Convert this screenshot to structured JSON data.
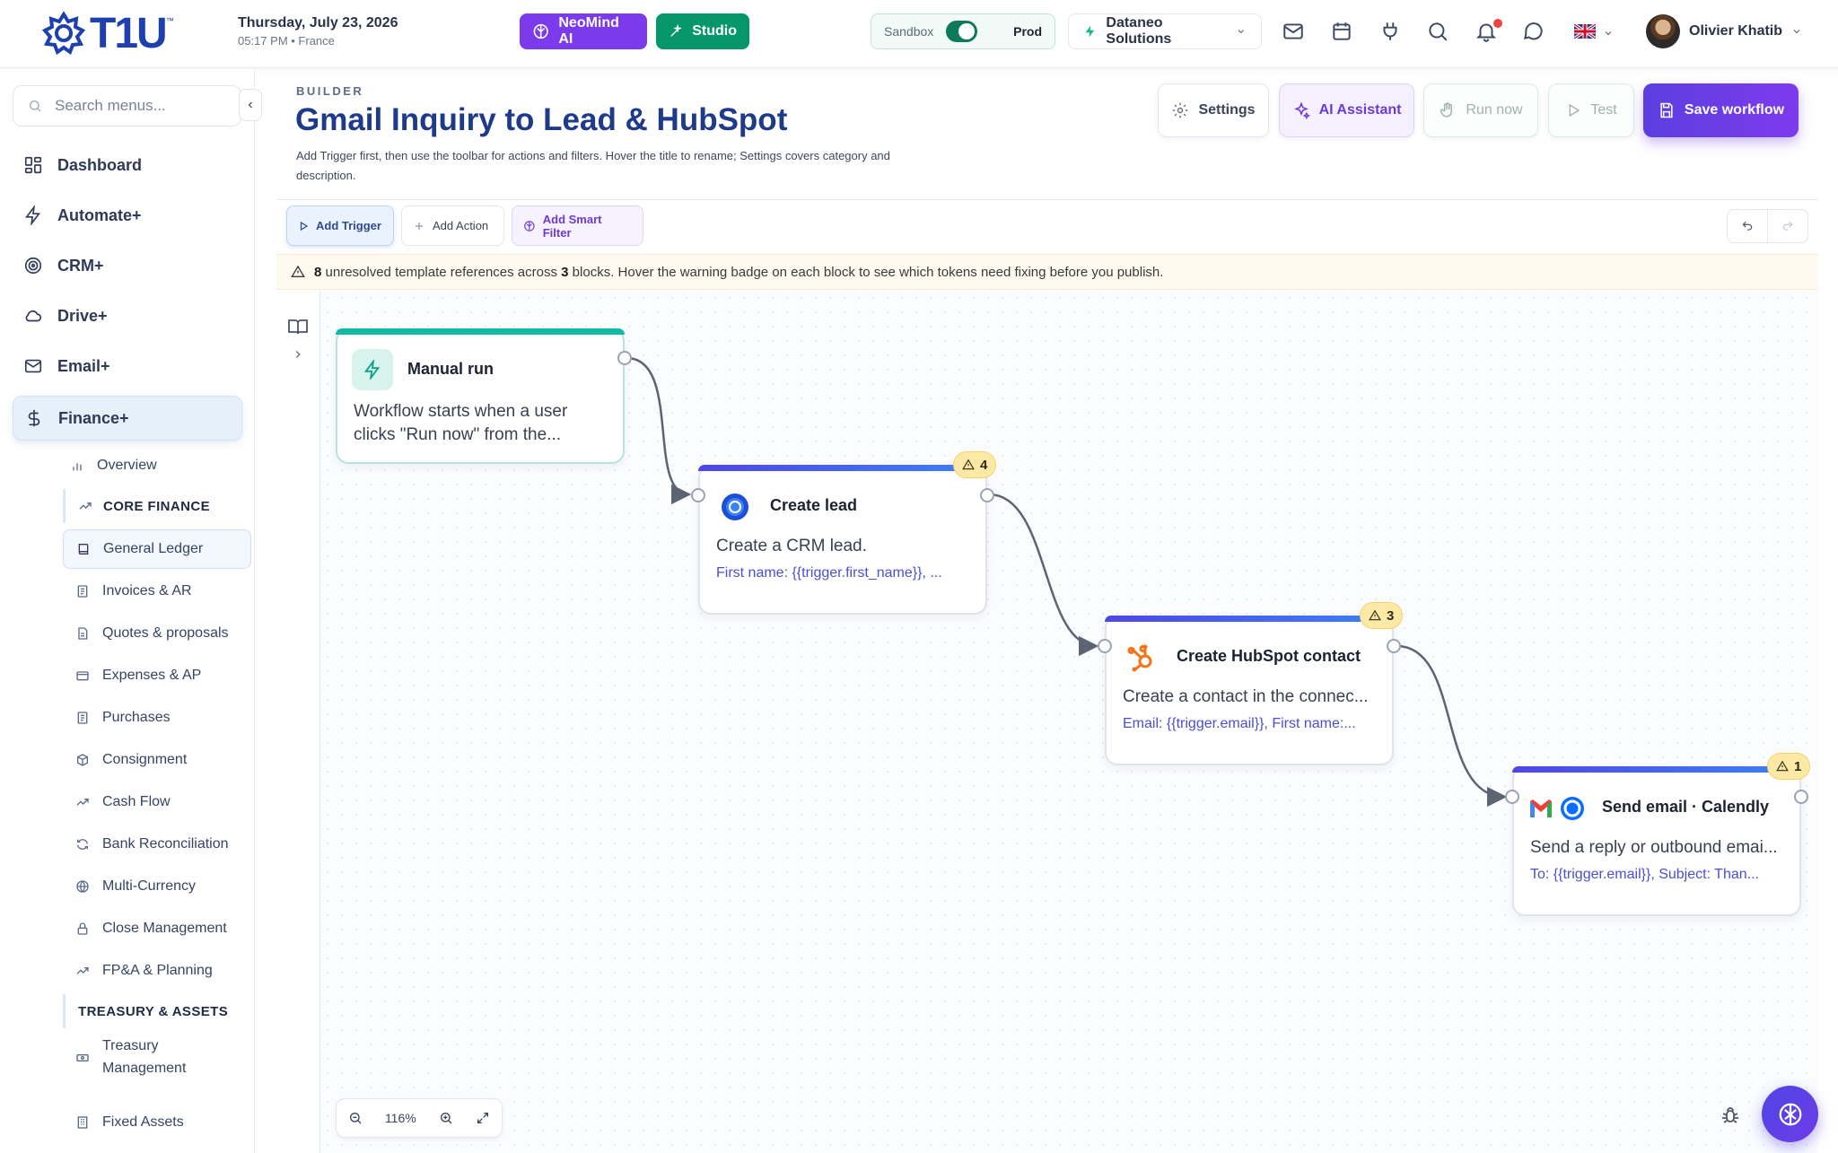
{
  "brand": {
    "name": "T1U",
    "tm": "™"
  },
  "header": {
    "date": "Thursday, July 23, 2026",
    "time_location": "05:17 PM • France",
    "neomind_label": "NeoMind AI",
    "studio_label": "Studio",
    "env_sandbox": "Sandbox",
    "env_prod": "Prod",
    "company": "Dataneo Solutions",
    "user_name": "Olivier Khatib"
  },
  "sidebar": {
    "search_placeholder": "Search menus...",
    "main_items": [
      {
        "label": "Dashboard",
        "icon": "dashboard-icon"
      },
      {
        "label": "Automate+",
        "icon": "bolt-icon"
      },
      {
        "label": "CRM+",
        "icon": "target-icon"
      },
      {
        "label": "Drive+",
        "icon": "cloud-icon"
      },
      {
        "label": "Email+",
        "icon": "mail-icon"
      },
      {
        "label": "Finance+",
        "icon": "dollar-icon"
      }
    ],
    "finance_items": [
      {
        "label": "Overview"
      },
      {
        "label": "CORE FINANCE"
      },
      {
        "label": "General Ledger"
      },
      {
        "label": "Invoices & AR"
      },
      {
        "label": "Quotes & proposals"
      },
      {
        "label": "Expenses & AP"
      },
      {
        "label": "Purchases"
      },
      {
        "label": "Consignment"
      },
      {
        "label": "Cash Flow"
      },
      {
        "label": "Bank Reconciliation"
      },
      {
        "label": "Multi-Currency"
      },
      {
        "label": "Close Management"
      },
      {
        "label": "FP&A & Planning"
      },
      {
        "label": "TREASURY & ASSETS"
      },
      {
        "label": "Treasury"
      },
      {
        "label": "Management"
      },
      {
        "label": "Fixed Assets"
      }
    ]
  },
  "page": {
    "section_label": "BUILDER",
    "title": "Gmail Inquiry to Lead & HubSpot",
    "description": "Add Trigger first, then use the toolbar for actions and filters. Hover the title to rename; Settings covers category and description.",
    "buttons": {
      "settings": "Settings",
      "ai_assistant": "AI Assistant",
      "run_now": "Run now",
      "test": "Test",
      "save": "Save workflow"
    },
    "toolbar": {
      "add_trigger": "Add Trigger",
      "add_action": "Add Action",
      "add_filter": "Add Smart Filter"
    },
    "warning": {
      "count": "8",
      "text_a": "unresolved template references across",
      "blocks": "3",
      "text_b": "blocks. Hover the warning badge on each block to see which tokens need fixing before you publish."
    },
    "zoom_level": "116%"
  },
  "nodes": [
    {
      "title": "Manual run",
      "desc_line1": "Workflow starts when a user",
      "desc_line2": "clicks \"Run now\" from the...",
      "accent": "#14b8a6"
    },
    {
      "title": "Create lead",
      "desc": "Create a CRM lead.",
      "token": "First name: {{trigger.first_name}}, ...",
      "warnings": "4",
      "accent": "#3b82f6"
    },
    {
      "title": "Create HubSpot contact",
      "desc": "Create a contact in the connec...",
      "token": "Email: {{trigger.email}}, First name:...",
      "warnings": "3",
      "accent": "#3b82f6"
    },
    {
      "title": "Send email · Calendly",
      "desc": "Send a reply or outbound emai...",
      "token": "To: {{trigger.email}}, Subject: Than...",
      "warnings": "1",
      "accent": "#3b82f6"
    }
  ]
}
